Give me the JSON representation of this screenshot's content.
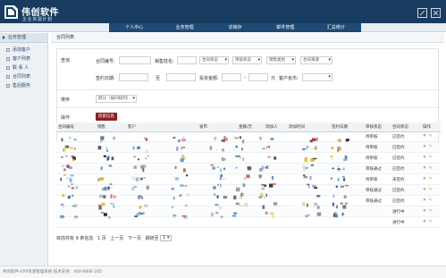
{
  "app": {
    "title": "伟创软件",
    "subtitle": "企业资源计划"
  },
  "header_icons": [
    "edit-icon",
    "fullscreen-icon"
  ],
  "topnav": [
    "个人中心",
    "业务管理",
    "进销存",
    "邮件管理",
    "汇总统计"
  ],
  "sidebar": {
    "header": "业务管理",
    "items": [
      "添加客户",
      "客户列表",
      "联 系 人",
      "合同列表",
      "售后服务"
    ]
  },
  "breadcrumb": "合同列表",
  "form": {
    "query_label": "查询",
    "row1": {
      "contract_no_label": "合同编号:",
      "sales_name_label": "销售姓名:",
      "contract_status": "合同状态",
      "review_status": "审核状态",
      "sales_type": "销售类别",
      "contract_source": "合同来源"
    },
    "row2": {
      "sign_date_label": "签约日期:",
      "to_label": "至",
      "invest_label": "投资金额:",
      "dash": "-",
      "unit": "元",
      "customer_province": "客户省市:"
    },
    "sort_label": "排序",
    "sort_option": "默认（按ID排列）",
    "action_label": "操作",
    "search_button": "检索信息"
  },
  "table": {
    "headers": [
      "合同编号",
      "销售",
      "客户",
      "省市",
      "金额/元",
      "添加人",
      "添加时间",
      "签约日期",
      "审核状态",
      "合同状态",
      "操作"
    ],
    "rows": [
      {
        "review": "待审核",
        "status": "已签约"
      },
      {
        "review": "待审核",
        "status": "已签约"
      },
      {
        "review": "待审核",
        "status": "已签约"
      },
      {
        "review": "审核通过",
        "status": "已签约"
      },
      {
        "review": "待审核",
        "status": "未签约"
      },
      {
        "review": "审核通过",
        "status": "已签约"
      },
      {
        "review": "审核通过",
        "status": "已签约"
      },
      {
        "review": "",
        "status": "进行中"
      },
      {
        "review": "",
        "status": "进行中"
      }
    ],
    "action_delete": "✕",
    "action_edit": "✎"
  },
  "pager": {
    "summary": "目前共有 9 条信息",
    "page_info": "1 页",
    "prev": "上一页",
    "next": "下一页",
    "jump": "跳转至",
    "page_value": "1"
  },
  "footer": "伟创软件-ERP资源管理系统 技术支持：400-0806-205",
  "colors": {
    "header_bg": "#173c5f",
    "nav_bg": "#1f4a73",
    "search_button": "#8c1f1f",
    "delete_action": "#c23a2a"
  }
}
